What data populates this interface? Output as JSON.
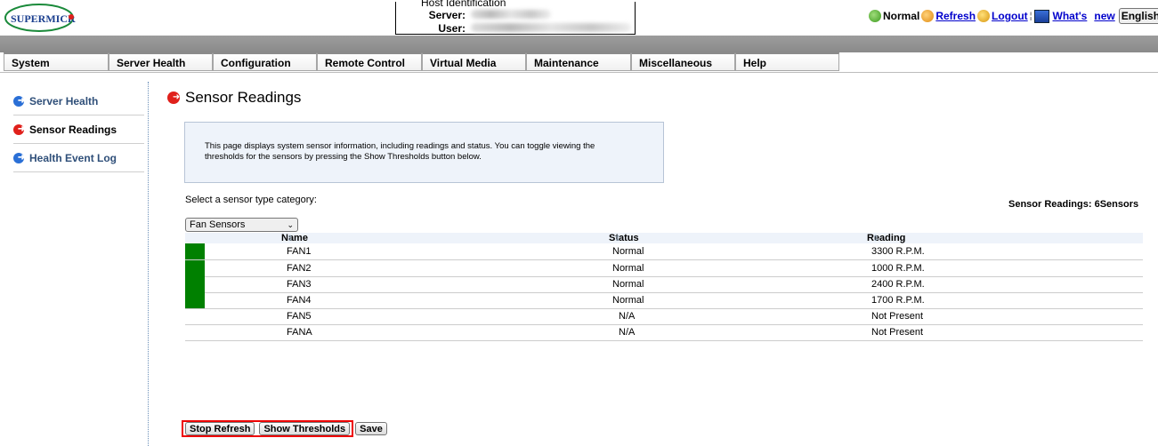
{
  "header": {
    "logo_text": "SUPERMICR",
    "host_title": "Host Identification",
    "server_label": "Server:",
    "user_label": "User:",
    "status_text": "Normal",
    "refresh_label": "Refresh",
    "logout_label": "Logout",
    "whats_new_label": "What's",
    "new_label": "new",
    "language": "English"
  },
  "nav": [
    {
      "label": "System"
    },
    {
      "label": "Server Health"
    },
    {
      "label": "Configuration"
    },
    {
      "label": "Remote Control"
    },
    {
      "label": "Virtual Media"
    },
    {
      "label": "Maintenance"
    },
    {
      "label": "Miscellaneous"
    },
    {
      "label": "Help"
    }
  ],
  "sidebar": {
    "items": [
      {
        "label": "Server Health",
        "active": false
      },
      {
        "label": "Sensor Readings",
        "active": true
      },
      {
        "label": "Health Event Log",
        "active": false
      }
    ]
  },
  "main": {
    "title": "Sensor Readings",
    "info_text": "This page displays system sensor information, including readings and status. You can toggle viewing the thresholds for the sensors by pressing the Show Thresholds button below.",
    "select_label": "Select a sensor type category:",
    "count_label": "Sensor Readings: 6Sensors",
    "selected_category": "Fan Sensors",
    "columns": [
      "Name",
      "Status",
      "Reading"
    ],
    "rows": [
      {
        "name": "FAN1",
        "status": "Normal",
        "reading": "3300 R.P.M.",
        "ok": true
      },
      {
        "name": "FAN2",
        "status": "Normal",
        "reading": "1000 R.P.M.",
        "ok": true
      },
      {
        "name": "FAN3",
        "status": "Normal",
        "reading": "2400 R.P.M.",
        "ok": true
      },
      {
        "name": "FAN4",
        "status": "Normal",
        "reading": "1700 R.P.M.",
        "ok": true
      },
      {
        "name": "FAN5",
        "status": "N/A",
        "reading": "Not Present",
        "ok": false
      },
      {
        "name": "FANA",
        "status": "N/A",
        "reading": "Not Present",
        "ok": false
      }
    ],
    "buttons": {
      "stop_refresh": "Stop Refresh",
      "show_thresholds": "Show Thresholds",
      "save": "Save"
    }
  },
  "colors": {
    "status_ok": "#008000",
    "active_arrow": "#e0201b",
    "inactive_arrow": "#2a6fd6",
    "highlight_box": "#ee0000"
  },
  "icons": {
    "status": "check-circle-icon",
    "refresh": "refresh-icon",
    "logout": "logout-icon",
    "whats_new": "monitor-icon",
    "nav_arrow": "arrow-right-icon"
  }
}
